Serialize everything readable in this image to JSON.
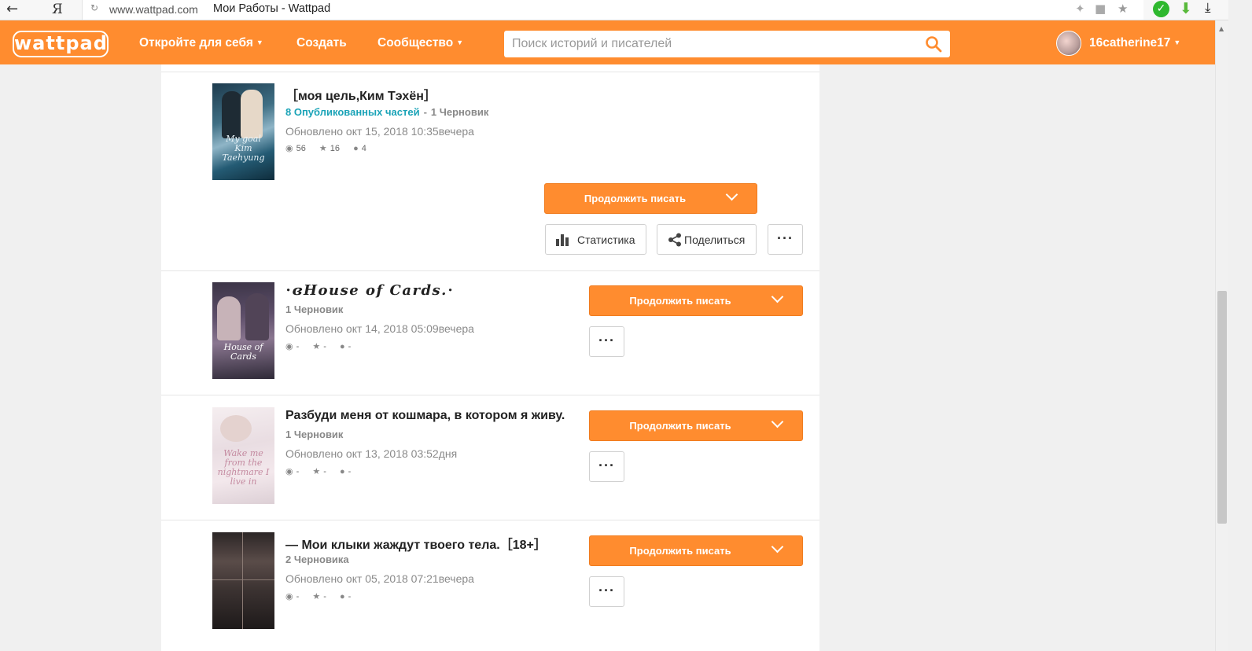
{
  "browser": {
    "url": "www.wattpad.com",
    "page_title": "Мои Работы - Wattpad",
    "yandex_glyph": "Я"
  },
  "header": {
    "logo": "wattpad",
    "nav": {
      "discover": "Откройте для себя",
      "create": "Создать",
      "community": "Сообщество"
    },
    "search_placeholder": "Поиск историй и писателей",
    "username": "16catherine17"
  },
  "stories": [
    {
      "title": "［моя цель,Ким Тэхён］",
      "published": "8 Опубликованных частей",
      "separator": "-",
      "drafts": "1 Черновик",
      "updated": "Обновлено окт 15, 2018 10:35вечера",
      "views": "56",
      "votes": "16",
      "comments": "4",
      "cover_text": "My goal Kim Taehyung",
      "continue_label": "Продолжить писать",
      "stats_label": "Статистика",
      "share_label": "Поделиться"
    },
    {
      "title": "⋅ɞHouse of Cards.⋅",
      "drafts": "1 Черновик",
      "updated": "Обновлено окт 14, 2018 05:09вечера",
      "views": "-",
      "votes": "-",
      "comments": "-",
      "cover_text": "House of Cards",
      "continue_label": "Продолжить писать"
    },
    {
      "title": "Разбуди меня от кошмара, в котором я живу.",
      "drafts": "1 Черновик",
      "updated": "Обновлено окт 13, 2018 03:52дня",
      "views": "-",
      "votes": "-",
      "comments": "-",
      "cover_text": "Wake me from the nightmare I live in",
      "continue_label": "Продолжить писать"
    },
    {
      "title": "— Мои клыки жаждут твоего тела.［18+］",
      "drafts": "2 Черновика",
      "updated": "Обновлено окт 05, 2018 07:21вечера",
      "views": "-",
      "votes": "-",
      "comments": "-",
      "continue_label": "Продолжить писать"
    }
  ],
  "icons": {
    "views": "eye-icon",
    "votes": "star-icon",
    "comments": "comment-icon",
    "more": "ellipsis-icon",
    "search": "search-icon"
  },
  "colors": {
    "brand": "#ff8c2f",
    "link": "#1aa3b7",
    "muted": "#8a8a8a"
  }
}
